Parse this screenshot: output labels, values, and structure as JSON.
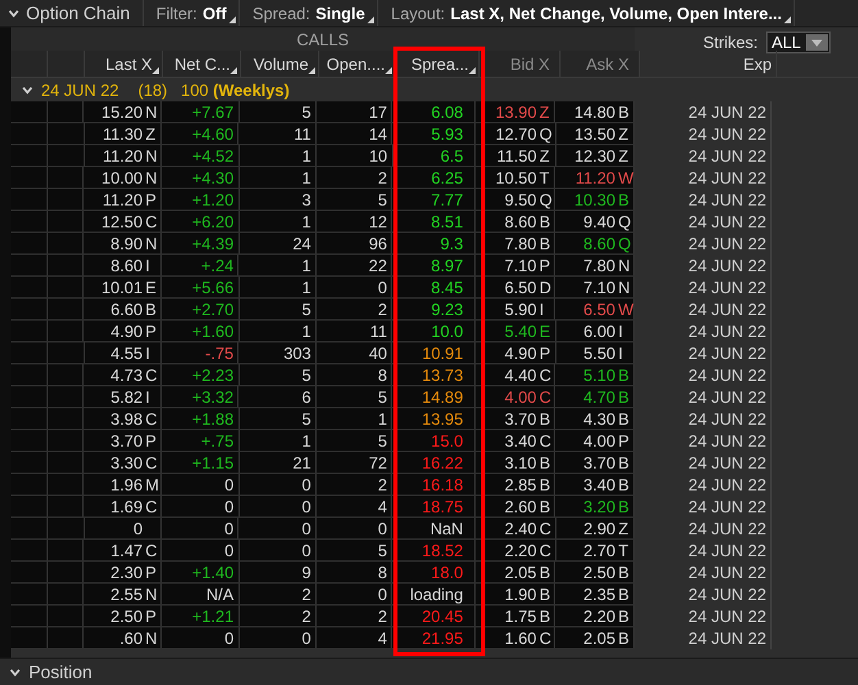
{
  "toolbar": {
    "title": "Option Chain",
    "filter": {
      "label": "Filter:",
      "value": "Off"
    },
    "spread": {
      "label": "Spread:",
      "value": "Single"
    },
    "layout": {
      "label": "Layout:",
      "value": "Last X, Net Change, Volume, Open Intere..."
    }
  },
  "section_title": "CALLS",
  "strikes": {
    "label": "Strikes:",
    "value": "ALL"
  },
  "columns": [
    {
      "label": "Last X",
      "sortable": true
    },
    {
      "label": "Net C...",
      "sortable": true
    },
    {
      "label": "Volume",
      "sortable": true
    },
    {
      "label": "Open....",
      "sortable": true
    },
    {
      "label": "Sprea...",
      "sortable": true
    },
    {
      "label": "Bid X",
      "sortable": false
    },
    {
      "label": "Ask X",
      "sortable": false
    },
    {
      "label": "Exp",
      "sortable": false
    }
  ],
  "group": {
    "expanded": true,
    "date": "24 JUN 22",
    "count": "(18)",
    "multiplier": "100 **(Weeklys)**"
  },
  "rows": [
    {
      "last": "15.20",
      "last_ex": "N",
      "net": {
        "text": "+7.67",
        "up": true,
        "down": false
      },
      "volume": "5",
      "open_int": "17",
      "spread": {
        "text": "6.08",
        "ok": true,
        "caution": false,
        "alert": false
      },
      "bid": {
        "text": "13.90",
        "exchange": "Z",
        "up": false,
        "down": true
      },
      "ask": {
        "text": "14.80",
        "exchange": "B",
        "up": false,
        "down": false
      },
      "exp": "24 JUN 22"
    },
    {
      "last": "11.30",
      "last_ex": "Z",
      "net": {
        "text": "+4.60",
        "up": true,
        "down": false
      },
      "volume": "11",
      "open_int": "14",
      "spread": {
        "text": "5.93",
        "ok": true,
        "caution": false,
        "alert": false
      },
      "bid": {
        "text": "12.70",
        "exchange": "Q",
        "up": false,
        "down": false
      },
      "ask": {
        "text": "13.50",
        "exchange": "Z",
        "up": false,
        "down": false
      },
      "exp": "24 JUN 22"
    },
    {
      "last": "11.20",
      "last_ex": "N",
      "net": {
        "text": "+4.52",
        "up": true,
        "down": false
      },
      "volume": "1",
      "open_int": "10",
      "spread": {
        "text": "6.5",
        "ok": true,
        "caution": false,
        "alert": false
      },
      "bid": {
        "text": "11.50",
        "exchange": "Z",
        "up": false,
        "down": false
      },
      "ask": {
        "text": "12.30",
        "exchange": "Z",
        "up": false,
        "down": false
      },
      "exp": "24 JUN 22"
    },
    {
      "last": "10.00",
      "last_ex": "N",
      "net": {
        "text": "+4.30",
        "up": true,
        "down": false
      },
      "volume": "1",
      "open_int": "2",
      "spread": {
        "text": "6.25",
        "ok": true,
        "caution": false,
        "alert": false
      },
      "bid": {
        "text": "10.50",
        "exchange": "T",
        "up": false,
        "down": false
      },
      "ask": {
        "text": "11.20",
        "exchange": "W",
        "up": false,
        "down": true
      },
      "exp": "24 JUN 22"
    },
    {
      "last": "11.20",
      "last_ex": "P",
      "net": {
        "text": "+1.20",
        "up": true,
        "down": false
      },
      "volume": "3",
      "open_int": "5",
      "spread": {
        "text": "7.77",
        "ok": true,
        "caution": false,
        "alert": false
      },
      "bid": {
        "text": "9.50",
        "exchange": "Q",
        "up": false,
        "down": false
      },
      "ask": {
        "text": "10.30",
        "exchange": "B",
        "up": true,
        "down": false
      },
      "exp": "24 JUN 22"
    },
    {
      "last": "12.50",
      "last_ex": "C",
      "net": {
        "text": "+6.20",
        "up": true,
        "down": false
      },
      "volume": "1",
      "open_int": "12",
      "spread": {
        "text": "8.51",
        "ok": true,
        "caution": false,
        "alert": false
      },
      "bid": {
        "text": "8.60",
        "exchange": "B",
        "up": false,
        "down": false
      },
      "ask": {
        "text": "9.40",
        "exchange": "Q",
        "up": false,
        "down": false
      },
      "exp": "24 JUN 22"
    },
    {
      "last": "8.90",
      "last_ex": "N",
      "net": {
        "text": "+4.39",
        "up": true,
        "down": false
      },
      "volume": "24",
      "open_int": "96",
      "spread": {
        "text": "9.3",
        "ok": true,
        "caution": false,
        "alert": false
      },
      "bid": {
        "text": "7.80",
        "exchange": "B",
        "up": false,
        "down": false
      },
      "ask": {
        "text": "8.60",
        "exchange": "Q",
        "up": true,
        "down": false
      },
      "exp": "24 JUN 22"
    },
    {
      "last": "8.60",
      "last_ex": "I",
      "net": {
        "text": "+.24",
        "up": true,
        "down": false
      },
      "volume": "1",
      "open_int": "22",
      "spread": {
        "text": "8.97",
        "ok": true,
        "caution": false,
        "alert": false
      },
      "bid": {
        "text": "7.10",
        "exchange": "P",
        "up": false,
        "down": false
      },
      "ask": {
        "text": "7.80",
        "exchange": "N",
        "up": false,
        "down": false
      },
      "exp": "24 JUN 22"
    },
    {
      "last": "10.01",
      "last_ex": "E",
      "net": {
        "text": "+5.66",
        "up": true,
        "down": false
      },
      "volume": "1",
      "open_int": "0",
      "spread": {
        "text": "8.45",
        "ok": true,
        "caution": false,
        "alert": false
      },
      "bid": {
        "text": "6.50",
        "exchange": "D",
        "up": false,
        "down": false
      },
      "ask": {
        "text": "7.10",
        "exchange": "N",
        "up": false,
        "down": false
      },
      "exp": "24 JUN 22"
    },
    {
      "last": "6.60",
      "last_ex": "B",
      "net": {
        "text": "+2.70",
        "up": true,
        "down": false
      },
      "volume": "5",
      "open_int": "2",
      "spread": {
        "text": "9.23",
        "ok": true,
        "caution": false,
        "alert": false
      },
      "bid": {
        "text": "5.90",
        "exchange": "I",
        "up": false,
        "down": false
      },
      "ask": {
        "text": "6.50",
        "exchange": "W",
        "up": false,
        "down": true
      },
      "exp": "24 JUN 22"
    },
    {
      "last": "4.90",
      "last_ex": "P",
      "net": {
        "text": "+1.60",
        "up": true,
        "down": false
      },
      "volume": "1",
      "open_int": "11",
      "spread": {
        "text": "10.0",
        "ok": true,
        "caution": false,
        "alert": false
      },
      "bid": {
        "text": "5.40",
        "exchange": "E",
        "up": true,
        "down": false
      },
      "ask": {
        "text": "6.00",
        "exchange": "I",
        "up": false,
        "down": false
      },
      "exp": "24 JUN 22"
    },
    {
      "last": "4.55",
      "last_ex": "I",
      "net": {
        "text": "-.75",
        "up": false,
        "down": true
      },
      "volume": "303",
      "open_int": "40",
      "spread": {
        "text": "10.91",
        "ok": false,
        "caution": true,
        "alert": false
      },
      "bid": {
        "text": "4.90",
        "exchange": "P",
        "up": false,
        "down": false
      },
      "ask": {
        "text": "5.50",
        "exchange": "I",
        "up": false,
        "down": false
      },
      "exp": "24 JUN 22"
    },
    {
      "last": "4.73",
      "last_ex": "C",
      "net": {
        "text": "+2.23",
        "up": true,
        "down": false
      },
      "volume": "5",
      "open_int": "8",
      "spread": {
        "text": "13.73",
        "ok": false,
        "caution": true,
        "alert": false
      },
      "bid": {
        "text": "4.40",
        "exchange": "C",
        "up": false,
        "down": false
      },
      "ask": {
        "text": "5.10",
        "exchange": "B",
        "up": true,
        "down": false
      },
      "exp": "24 JUN 22"
    },
    {
      "last": "5.82",
      "last_ex": "I",
      "net": {
        "text": "+3.32",
        "up": true,
        "down": false
      },
      "volume": "6",
      "open_int": "5",
      "spread": {
        "text": "14.89",
        "ok": false,
        "caution": true,
        "alert": false
      },
      "bid": {
        "text": "4.00",
        "exchange": "C",
        "up": false,
        "down": true
      },
      "ask": {
        "text": "4.70",
        "exchange": "B",
        "up": true,
        "down": false
      },
      "exp": "24 JUN 22"
    },
    {
      "last": "3.98",
      "last_ex": "C",
      "net": {
        "text": "+1.88",
        "up": true,
        "down": false
      },
      "volume": "5",
      "open_int": "1",
      "spread": {
        "text": "13.95",
        "ok": false,
        "caution": true,
        "alert": false
      },
      "bid": {
        "text": "3.70",
        "exchange": "B",
        "up": false,
        "down": false
      },
      "ask": {
        "text": "4.30",
        "exchange": "B",
        "up": false,
        "down": false
      },
      "exp": "24 JUN 22"
    },
    {
      "last": "3.70",
      "last_ex": "P",
      "net": {
        "text": "+.75",
        "up": true,
        "down": false
      },
      "volume": "1",
      "open_int": "5",
      "spread": {
        "text": "15.0",
        "ok": false,
        "caution": false,
        "alert": true
      },
      "bid": {
        "text": "3.40",
        "exchange": "C",
        "up": false,
        "down": false
      },
      "ask": {
        "text": "4.00",
        "exchange": "P",
        "up": false,
        "down": false
      },
      "exp": "24 JUN 22"
    },
    {
      "last": "3.30",
      "last_ex": "C",
      "net": {
        "text": "+1.15",
        "up": true,
        "down": false
      },
      "volume": "21",
      "open_int": "72",
      "spread": {
        "text": "16.22",
        "ok": false,
        "caution": false,
        "alert": true
      },
      "bid": {
        "text": "3.10",
        "exchange": "B",
        "up": false,
        "down": false
      },
      "ask": {
        "text": "3.70",
        "exchange": "B",
        "up": false,
        "down": false
      },
      "exp": "24 JUN 22"
    },
    {
      "last": "1.96",
      "last_ex": "M",
      "net": {
        "text": "0",
        "up": false,
        "down": false
      },
      "volume": "0",
      "open_int": "2",
      "spread": {
        "text": "16.18",
        "ok": false,
        "caution": false,
        "alert": true
      },
      "bid": {
        "text": "2.85",
        "exchange": "B",
        "up": false,
        "down": false
      },
      "ask": {
        "text": "3.40",
        "exchange": "B",
        "up": false,
        "down": false
      },
      "exp": "24 JUN 22"
    },
    {
      "last": "1.69",
      "last_ex": "C",
      "net": {
        "text": "0",
        "up": false,
        "down": false
      },
      "volume": "0",
      "open_int": "4",
      "spread": {
        "text": "18.75",
        "ok": false,
        "caution": false,
        "alert": true
      },
      "bid": {
        "text": "2.60",
        "exchange": "B",
        "up": false,
        "down": false
      },
      "ask": {
        "text": "3.20",
        "exchange": "B",
        "up": true,
        "down": false
      },
      "exp": "24 JUN 22"
    },
    {
      "last": "0",
      "net": {
        "text": "0",
        "up": false,
        "down": false
      },
      "volume": "0",
      "open_int": "0",
      "spread": {
        "text": "NaN",
        "ok": false,
        "caution": false,
        "alert": false
      },
      "bid": {
        "text": "2.40",
        "exchange": "C",
        "up": false,
        "down": false
      },
      "ask": {
        "text": "2.90",
        "exchange": "Z",
        "up": false,
        "down": false
      },
      "exp": "24 JUN 22"
    },
    {
      "last": "1.47",
      "last_ex": "C",
      "net": {
        "text": "0",
        "up": false,
        "down": false
      },
      "volume": "0",
      "open_int": "5",
      "spread": {
        "text": "18.52",
        "ok": false,
        "caution": false,
        "alert": true
      },
      "bid": {
        "text": "2.20",
        "exchange": "C",
        "up": false,
        "down": false
      },
      "ask": {
        "text": "2.70",
        "exchange": "T",
        "up": false,
        "down": false
      },
      "exp": "24 JUN 22"
    },
    {
      "last": "2.30",
      "last_ex": "P",
      "net": {
        "text": "+1.40",
        "up": true,
        "down": false
      },
      "volume": "9",
      "open_int": "8",
      "spread": {
        "text": "18.0",
        "ok": false,
        "caution": false,
        "alert": true
      },
      "bid": {
        "text": "2.05",
        "exchange": "B",
        "up": false,
        "down": false
      },
      "ask": {
        "text": "2.50",
        "exchange": "B",
        "up": false,
        "down": false
      },
      "exp": "24 JUN 22"
    },
    {
      "last": "2.55",
      "last_ex": "N",
      "net": {
        "text": "N/A",
        "up": false,
        "down": false
      },
      "volume": "2",
      "open_int": "0",
      "spread": {
        "text": "loading",
        "ok": false,
        "caution": false,
        "alert": false
      },
      "bid": {
        "text": "1.90",
        "exchange": "B",
        "up": false,
        "down": false
      },
      "ask": {
        "text": "2.35",
        "exchange": "B",
        "up": false,
        "down": false
      },
      "exp": "24 JUN 22"
    },
    {
      "last": "2.50",
      "last_ex": "P",
      "net": {
        "text": "+1.21",
        "up": true,
        "down": false
      },
      "volume": "2",
      "open_int": "2",
      "spread": {
        "text": "20.45",
        "ok": false,
        "caution": false,
        "alert": true
      },
      "bid": {
        "text": "1.75",
        "exchange": "B",
        "up": false,
        "down": false
      },
      "ask": {
        "text": "2.20",
        "exchange": "B",
        "up": false,
        "down": false
      },
      "exp": "24 JUN 22"
    },
    {
      "last": ".60",
      "last_ex": "N",
      "net": {
        "text": "0",
        "up": false,
        "down": false
      },
      "volume": "0",
      "open_int": "4",
      "spread": {
        "text": "21.95",
        "ok": false,
        "caution": false,
        "alert": true
      },
      "bid": {
        "text": "1.60",
        "exchange": "C",
        "up": false,
        "down": false
      },
      "ask": {
        "text": "2.05",
        "exchange": "B",
        "up": false,
        "down": false
      },
      "exp": "24 JUN 22"
    }
  ],
  "highlight": {
    "shown": true
  },
  "footer": {
    "title": "Position",
    "expanded": true
  }
}
